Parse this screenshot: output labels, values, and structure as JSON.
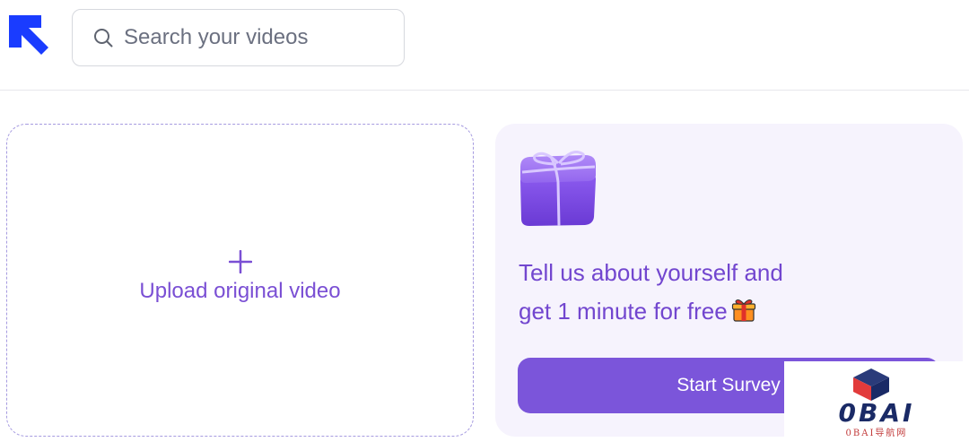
{
  "header": {
    "logo_icon": "arrow-up-left-logo-icon",
    "search": {
      "icon": "search-icon",
      "placeholder": "Search your videos",
      "value": ""
    }
  },
  "upload": {
    "icon": "plus-icon",
    "label": "Upload original video"
  },
  "promo": {
    "image": "gift-box-icon",
    "line1": "Tell us about yourself and",
    "line2": "get 1 minute for free",
    "emoji": "gift-emoji-icon",
    "button_label": "Start Survey"
  },
  "watermark": {
    "icon": "cube-logo-icon",
    "title": "0BAI",
    "subtitle": "0BAI导航网"
  },
  "colors": {
    "brand_blue": "#1a3cff",
    "accent_purple": "#7b55da",
    "text_purple": "#7246cf",
    "promo_bg": "#f6f3fd",
    "dashed_border": "#a69be0"
  }
}
